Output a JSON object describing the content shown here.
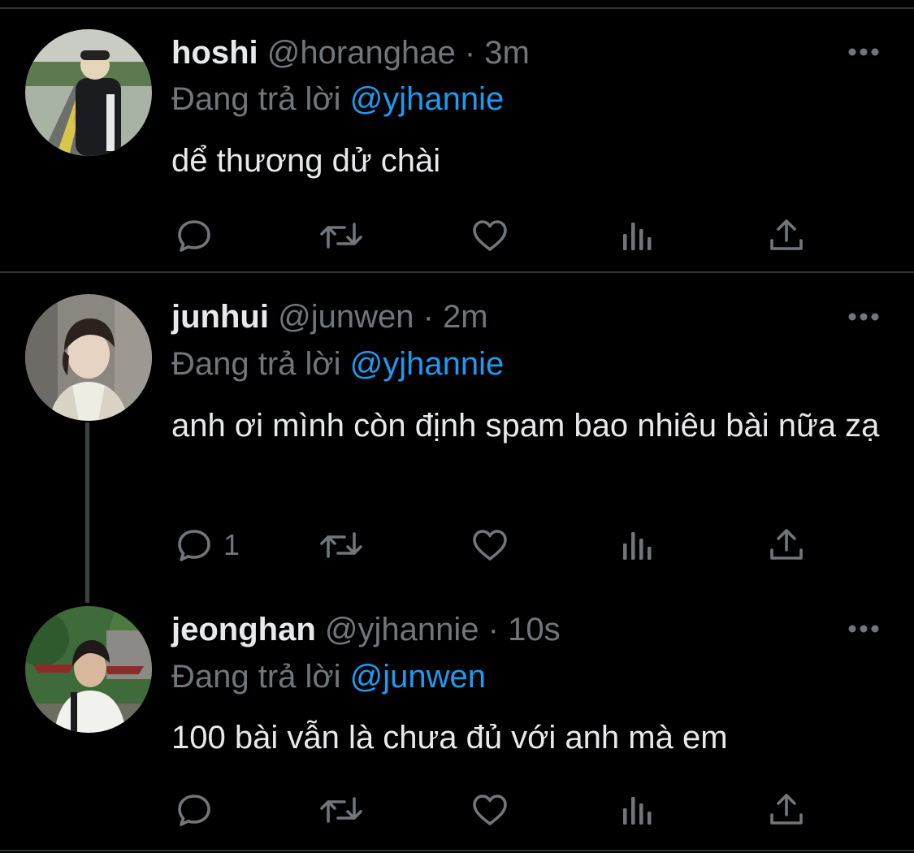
{
  "colors": {
    "background": "#000000",
    "text": "#e7e9ea",
    "muted": "#71767b",
    "accent": "#1d9bf0",
    "divider": "#2f3336"
  },
  "tweets": [
    {
      "name": "hoshi",
      "handle": "@horanghae",
      "separator": "·",
      "time": "3m",
      "reply_prefix": "Đang trả lời",
      "reply_to": "@yjhannie",
      "text": "dể thương dử chài",
      "reply_count": "",
      "avatar": "avatar-hoshi"
    },
    {
      "name": "junhui",
      "handle": "@junwen",
      "separator": "·",
      "time": "2m",
      "reply_prefix": "Đang trả lời",
      "reply_to": "@yjhannie",
      "text": "anh ơi mình còn định spam bao nhiêu bài nữa zạ",
      "reply_count": "1",
      "avatar": "avatar-junhui"
    },
    {
      "name": "jeonghan",
      "handle": "@yjhannie",
      "separator": "·",
      "time": "10s",
      "reply_prefix": "Đang trả lời",
      "reply_to": "@junwen",
      "text": "100 bài vẫn là chưa đủ với anh mà em",
      "reply_count": "",
      "avatar": "avatar-jeonghan"
    }
  ],
  "icons": {
    "more": "more-horizontal-icon",
    "reply": "reply-bubble-icon",
    "retweet": "retweet-icon",
    "like": "heart-icon",
    "views": "views-bar-chart-icon",
    "share": "share-upload-icon"
  }
}
